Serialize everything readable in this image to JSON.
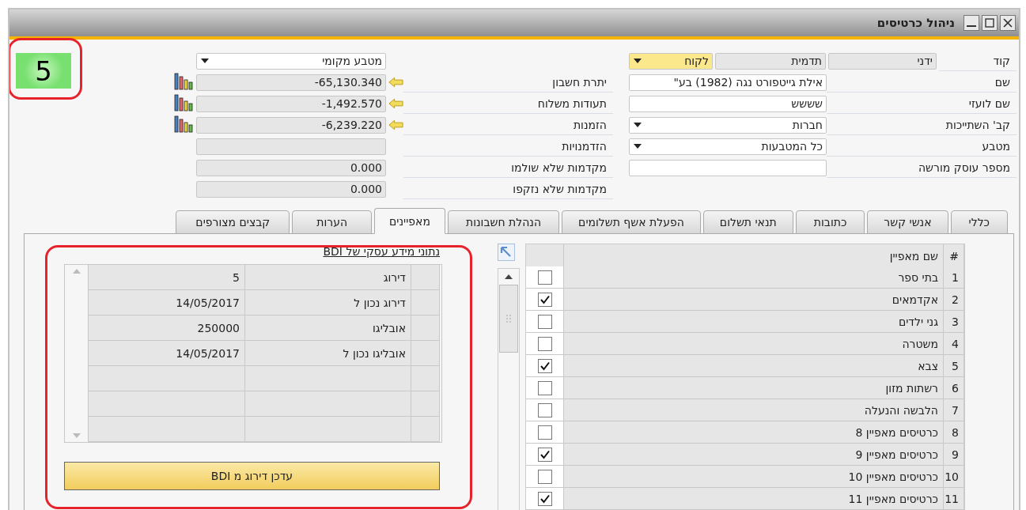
{
  "window": {
    "title": "ניהול כרטיסים"
  },
  "rating_badge": {
    "text": "5"
  },
  "card_fields": {
    "code_label": "קוד",
    "code_controls": [
      {
        "kind": "readonly",
        "text": "ידני"
      },
      {
        "kind": "readonly",
        "text": "תדמית"
      },
      {
        "kind": "dropdown",
        "text": "לקוח",
        "highlight": true
      }
    ],
    "rows": [
      {
        "label": "שם",
        "kind": "text",
        "value": "אילת גייטפורט נגה (1982) בע\""
      },
      {
        "label": "שם לועזי",
        "kind": "text",
        "value": "שששש"
      },
      {
        "label": "קב' השתייכות",
        "kind": "dropdown",
        "value": "חברות"
      },
      {
        "label": "מטבע",
        "kind": "dropdown",
        "value": "כל המטבעות"
      },
      {
        "label": "מספר עוסק מורשה",
        "kind": "text"
      }
    ]
  },
  "balances": {
    "currency": "מטבע מקומי",
    "rows": [
      {
        "label": "יתרת חשבון",
        "value": "-65,130.340",
        "drilldown": true
      },
      {
        "label": "תעודות משלוח",
        "value": "-1,492.570",
        "drilldown": true
      },
      {
        "label": "הזמנות",
        "value": "-6,239.220",
        "drilldown": true
      },
      {
        "label": "הזדמנויות",
        "drilldown": false
      },
      {
        "label": "מקדמות שלא שולמו",
        "value": "0.000",
        "drilldown": false
      },
      {
        "label": "מקדמות שלא נזקפו",
        "value": "0.000",
        "drilldown": false
      }
    ]
  },
  "tabs": [
    {
      "label": "כללי",
      "selected": false
    },
    {
      "label": "אנשי קשר",
      "selected": false
    },
    {
      "label": "כתובות",
      "selected": false
    },
    {
      "label": "תנאי תשלום",
      "selected": false
    },
    {
      "label": "הפעלת אשף תשלומים",
      "selected": false
    },
    {
      "label": "הנהלת חשבונות",
      "selected": false
    },
    {
      "label": "מאפיינים",
      "selected": true
    },
    {
      "label": "הערות",
      "selected": false
    },
    {
      "label": "קבצים מצורפים",
      "selected": false
    }
  ],
  "properties": {
    "columns": [
      "#",
      "שם מאפיין"
    ],
    "rows": [
      {
        "number": "1",
        "name": "בתי ספר",
        "checked": false
      },
      {
        "number": "2",
        "name": "אקדמאים",
        "checked": true
      },
      {
        "number": "3",
        "name": "גני ילדים",
        "checked": false
      },
      {
        "number": "4",
        "name": "משטרה",
        "checked": false
      },
      {
        "number": "5",
        "name": "צבא",
        "checked": true
      },
      {
        "number": "6",
        "name": "רשתות מזון",
        "checked": false
      },
      {
        "number": "7",
        "name": "הלבשה והנעלה",
        "checked": false
      },
      {
        "number": "8",
        "name": "כרטיסים מאפיין 8",
        "checked": false
      },
      {
        "number": "9",
        "name": "כרטיסים מאפיין 9",
        "checked": true
      },
      {
        "number": "10",
        "name": "כרטיסים מאפיין 10",
        "checked": false
      },
      {
        "number": "11",
        "name": "כרטיסים מאפיין 11",
        "checked": true
      }
    ]
  },
  "bdi": {
    "title": "נתוני מידע עסקי של BDI",
    "rows": [
      {
        "label": "דירוג",
        "value": "5"
      },
      {
        "label": "דירוג נכון ל",
        "value": "14/05/2017"
      },
      {
        "label": "אובליגו",
        "value": "250000"
      },
      {
        "label": "אובליגו נכון ל",
        "value": "14/05/2017"
      }
    ],
    "button": "עדכן דירוג מ BDI"
  }
}
